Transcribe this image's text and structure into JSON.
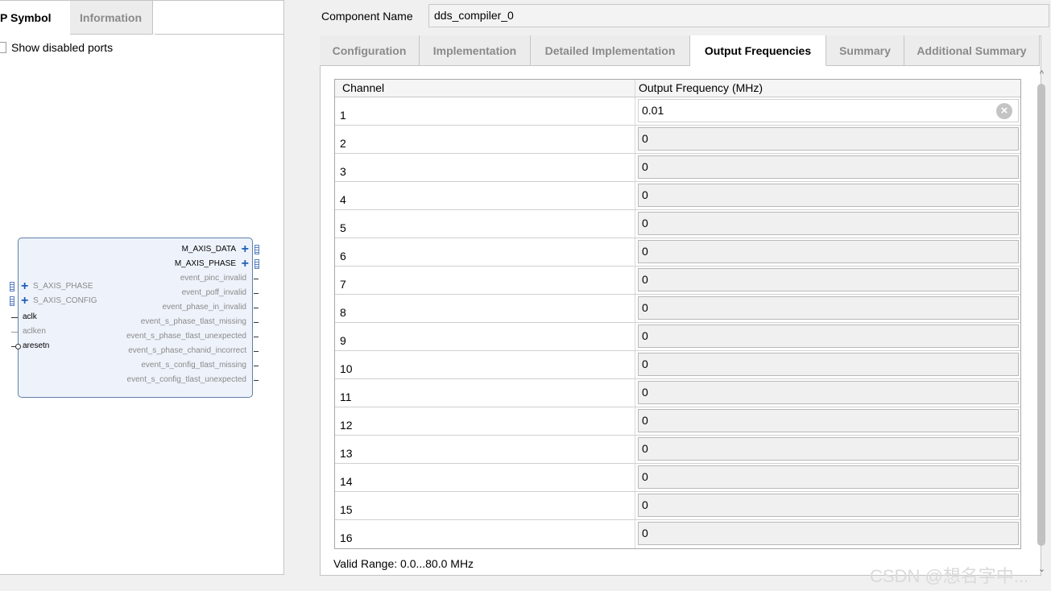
{
  "left": {
    "tabs": [
      "P Symbol",
      "Information"
    ],
    "show_disabled_label": "Show disabled ports",
    "symbol": {
      "right_ports": [
        {
          "name": "M_AXIS_DATA",
          "kind": "bus"
        },
        {
          "name": "M_AXIS_PHASE",
          "kind": "bus"
        },
        {
          "name": "event_pinc_invalid",
          "kind": "dim"
        },
        {
          "name": "event_poff_invalid",
          "kind": "dim"
        },
        {
          "name": "event_phase_in_invalid",
          "kind": "dim"
        },
        {
          "name": "event_s_phase_tlast_missing",
          "kind": "dim"
        },
        {
          "name": "event_s_phase_tlast_unexpected",
          "kind": "dim"
        },
        {
          "name": "event_s_phase_chanid_incorrect",
          "kind": "dim"
        },
        {
          "name": "event_s_config_tlast_missing",
          "kind": "dim"
        },
        {
          "name": "event_s_config_tlast_unexpected",
          "kind": "dim"
        }
      ],
      "left_ports": [
        {
          "name": "S_AXIS_PHASE",
          "kind": "bus"
        },
        {
          "name": "S_AXIS_CONFIG",
          "kind": "bus"
        },
        {
          "name": "aclk",
          "kind": "pin"
        },
        {
          "name": "aclken",
          "kind": "dim"
        },
        {
          "name": "aresetn",
          "kind": "reset"
        }
      ]
    }
  },
  "right": {
    "component_label": "Component Name",
    "component_value": "dds_compiler_0",
    "tabs": [
      {
        "label": "Configuration",
        "active": false
      },
      {
        "label": "Implementation",
        "active": false
      },
      {
        "label": "Detailed Implementation",
        "active": false
      },
      {
        "label": "Output Frequencies",
        "active": true
      },
      {
        "label": "Summary",
        "active": false
      },
      {
        "label": "Additional Summary",
        "active": false
      }
    ],
    "table": {
      "headers": [
        "Channel",
        "Output Frequency (MHz)"
      ],
      "rows": [
        {
          "channel": "1",
          "freq": "0.01"
        },
        {
          "channel": "2",
          "freq": "0"
        },
        {
          "channel": "3",
          "freq": "0"
        },
        {
          "channel": "4",
          "freq": "0"
        },
        {
          "channel": "5",
          "freq": "0"
        },
        {
          "channel": "6",
          "freq": "0"
        },
        {
          "channel": "7",
          "freq": "0"
        },
        {
          "channel": "8",
          "freq": "0"
        },
        {
          "channel": "9",
          "freq": "0"
        },
        {
          "channel": "10",
          "freq": "0"
        },
        {
          "channel": "11",
          "freq": "0"
        },
        {
          "channel": "12",
          "freq": "0"
        },
        {
          "channel": "13",
          "freq": "0"
        },
        {
          "channel": "14",
          "freq": "0"
        },
        {
          "channel": "15",
          "freq": "0"
        },
        {
          "channel": "16",
          "freq": "0"
        }
      ]
    },
    "valid_range": "Valid Range: 0.0...80.0 MHz"
  },
  "watermark": "CSDN @想名字中..."
}
